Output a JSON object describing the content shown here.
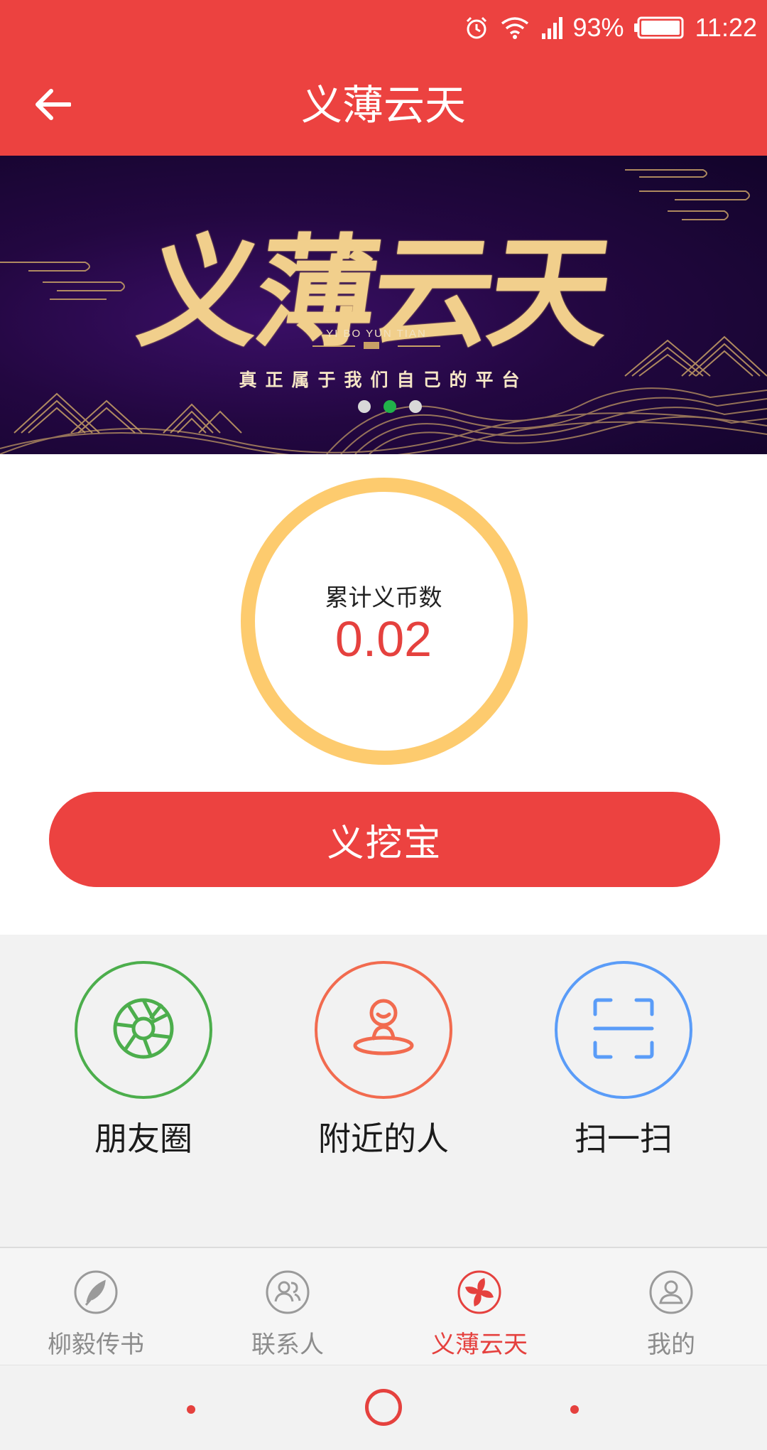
{
  "status_bar": {
    "battery": "93%",
    "time": "11:22",
    "icons": [
      "alarm-icon",
      "wifi-icon",
      "signal-icon",
      "battery-icon"
    ]
  },
  "header": {
    "title": "义薄云天",
    "back_icon": "arrow-left-icon"
  },
  "banner": {
    "title": "义薄云天",
    "pinyin": "YI BO YUN TIAN",
    "slogan": "真正属于我们自己的平台",
    "slides": 3,
    "active_slide": 2
  },
  "coins": {
    "label": "累计义币数",
    "value": "0.02"
  },
  "dig_button": {
    "label": "义挖宝"
  },
  "features": [
    {
      "label": "朋友圈",
      "icon": "aperture-icon",
      "color": "#4cae4c"
    },
    {
      "label": "附近的人",
      "icon": "person-location-icon",
      "color": "#f26b4f"
    },
    {
      "label": "扫一扫",
      "icon": "scan-icon",
      "color": "#5a9cf8"
    }
  ],
  "tabs": [
    {
      "label": "柳毅传书",
      "icon": "feather-icon",
      "active": false
    },
    {
      "label": "联系人",
      "icon": "contacts-icon",
      "active": false
    },
    {
      "label": "义薄云天",
      "icon": "pinwheel-icon",
      "active": true
    },
    {
      "label": "我的",
      "icon": "profile-icon",
      "active": false
    }
  ],
  "colors": {
    "primary": "#ec4240",
    "ring": "#fdcb6e",
    "active_tab": "#e5413e",
    "inactive_tab": "#8c8c8c"
  }
}
